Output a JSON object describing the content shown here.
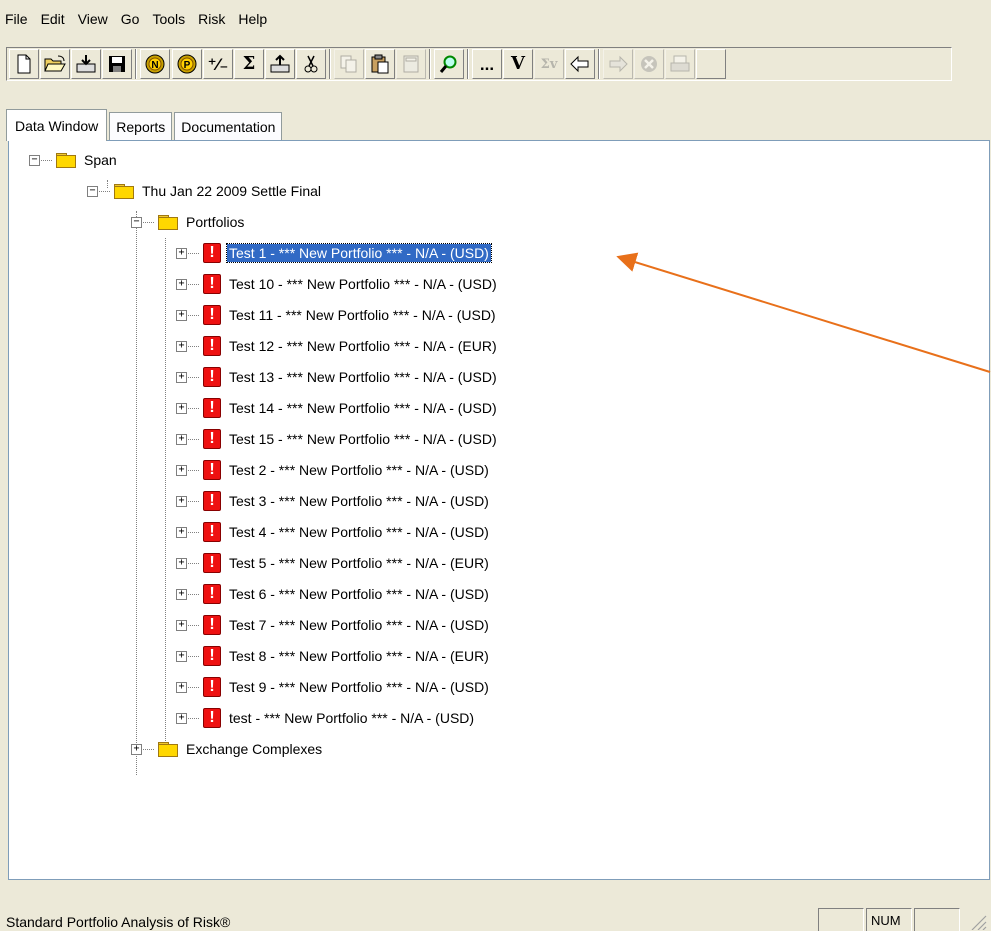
{
  "menu": [
    "File",
    "Edit",
    "View",
    "Go",
    "Tools",
    "Risk",
    "Help"
  ],
  "toolbar": {
    "glyph_pct": "⁺⁄₋",
    "glyph_sigma": "Σ",
    "glyph_ellipsis": "...",
    "glyph_v": "V",
    "glyph_sigma_v": "Σv",
    "icons": [
      "new-document-icon",
      "open-folder-icon",
      "import-icon",
      "save-icon",
      "n-coin-icon",
      "p-coin-icon",
      "percent-icon",
      "sigma-icon",
      "export-icon",
      "cut-icon",
      "copy-icon",
      "paste-icon",
      "calculator-icon",
      "search-icon",
      "ellipsis-icon",
      "v-icon",
      "sigma-v-icon",
      "back-arrow-icon",
      "forward-arrow-icon",
      "stop-icon",
      "print-icon"
    ]
  },
  "tabs": [
    {
      "label": "Data Window",
      "active": true
    },
    {
      "label": "Reports",
      "active": false
    },
    {
      "label": "Documentation",
      "active": false
    }
  ],
  "tree": {
    "root": "Span",
    "settlement": "Thu Jan 22 2009 Settle Final",
    "portfolios_label": "Portfolios",
    "portfolios": [
      "Test 1 - *** New Portfolio *** - N/A - (USD)",
      "Test 10 - *** New Portfolio *** - N/A - (USD)",
      "Test 11 - *** New Portfolio *** - N/A - (USD)",
      "Test 12 - *** New Portfolio *** - N/A - (EUR)",
      "Test 13 - *** New Portfolio *** - N/A - (USD)",
      "Test 14 - *** New Portfolio *** - N/A - (USD)",
      "Test 15 - *** New Portfolio *** - N/A - (USD)",
      "Test 2 - *** New Portfolio *** - N/A - (USD)",
      "Test 3 - *** New Portfolio *** - N/A - (USD)",
      "Test 4 - *** New Portfolio *** - N/A - (USD)",
      "Test 5 - *** New Portfolio *** - N/A - (EUR)",
      "Test 6 - *** New Portfolio *** - N/A - (USD)",
      "Test 7 - *** New Portfolio *** - N/A - (USD)",
      "Test 8 - *** New Portfolio *** - N/A - (EUR)",
      "Test 9 - *** New Portfolio *** - N/A - (USD)",
      "test - *** New Portfolio *** - N/A - (USD)"
    ],
    "selected_index": 0,
    "exchange_label": "Exchange Complexes",
    "expand_symbol": "+",
    "collapse_symbol": "−",
    "alert_symbol": "!"
  },
  "status": {
    "text": "Standard Portfolio Analysis of Risk®",
    "num": "NUM"
  },
  "colors": {
    "selection": "#316ac5",
    "alert": "#ee1111",
    "folder": "#ffd700",
    "annotation_arrow": "#e8701a"
  }
}
